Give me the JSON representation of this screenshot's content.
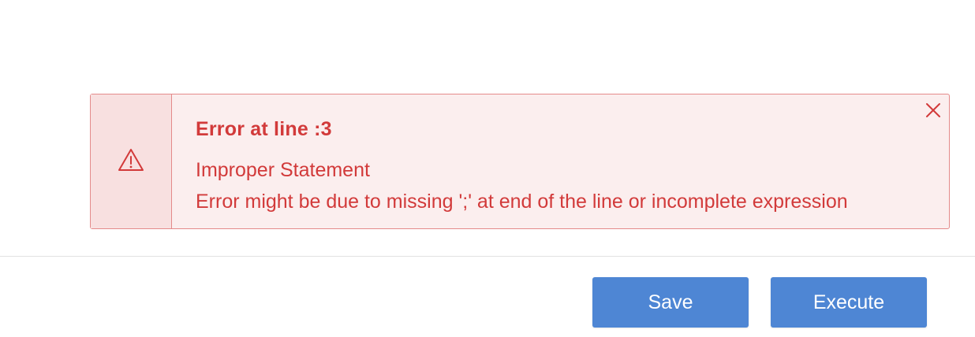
{
  "error_alert": {
    "title": "Error at line :3",
    "message_line1": "Improper Statement",
    "message_line2": "Error might be due to missing ';' at end of the line or incomplete expression",
    "icon": "warning-triangle-icon",
    "close_icon": "close-icon",
    "colors": {
      "text": "#d23a3a",
      "border": "#e48a8a",
      "background": "#fbeeee",
      "icon_panel_background": "#f8e0e0"
    }
  },
  "footer": {
    "save_label": "Save",
    "execute_label": "Execute",
    "button_color": "#4e86d4"
  }
}
